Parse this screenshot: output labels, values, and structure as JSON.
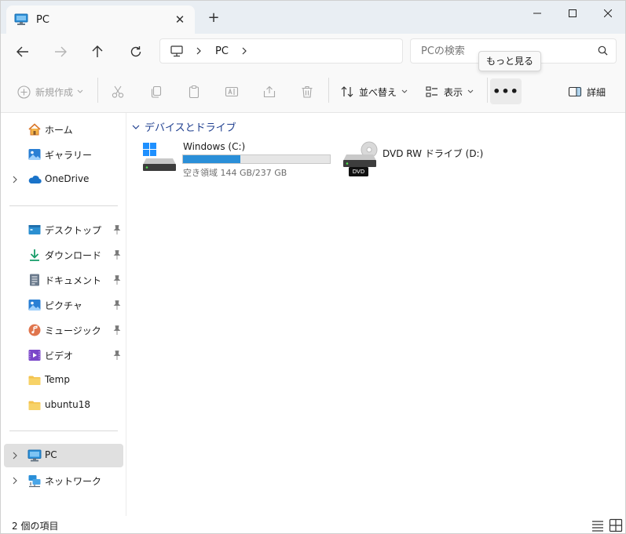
{
  "window": {
    "tab_title": "PC",
    "tab_icon": "computer-icon",
    "close_tab_icon": "close-icon",
    "new_tab_icon": "plus-icon"
  },
  "address": {
    "segments": [
      "PC"
    ],
    "search_placeholder": "PCの検索"
  },
  "toolbar": {
    "new_label": "新規作成",
    "sort_label": "並べ替え",
    "view_label": "表示",
    "details_label": "詳細",
    "more_tooltip": "もっと見る",
    "more_glyph": "•••"
  },
  "sidebar": {
    "home": "ホーム",
    "gallery": "ギャラリー",
    "onedrive": "OneDrive",
    "pinned": [
      {
        "label": "デスクトップ",
        "icon": "desktop-icon",
        "color": "#2b8fd1"
      },
      {
        "label": "ダウンロード",
        "icon": "download-icon",
        "color": "#1a9e6b"
      },
      {
        "label": "ドキュメント",
        "icon": "document-icon",
        "color": "#6a7a8c"
      },
      {
        "label": "ピクチャ",
        "icon": "pictures-icon",
        "color": "#2a7fd4"
      },
      {
        "label": "ミュージック",
        "icon": "music-icon",
        "color": "#e0754d"
      },
      {
        "label": "ビデオ",
        "icon": "video-icon",
        "color": "#7a46c9"
      }
    ],
    "folders": [
      "Temp",
      "ubuntu18"
    ],
    "pc": "PC",
    "network": "ネットワーク"
  },
  "content": {
    "group_title": "デバイスとドライブ",
    "drives": [
      {
        "name": "Windows  (C:)",
        "free_text": "空き領域 144 GB/237 GB",
        "used_fraction": 0.39
      },
      {
        "name": "DVD RW ドライブ (D:)",
        "badge": "DVD"
      }
    ]
  },
  "status": {
    "item_count": "2 個の項目"
  },
  "colors": {
    "accent": "#2a8fd8",
    "selected_bg": "#e0e0e0",
    "group_header": "#1f3f8f"
  }
}
